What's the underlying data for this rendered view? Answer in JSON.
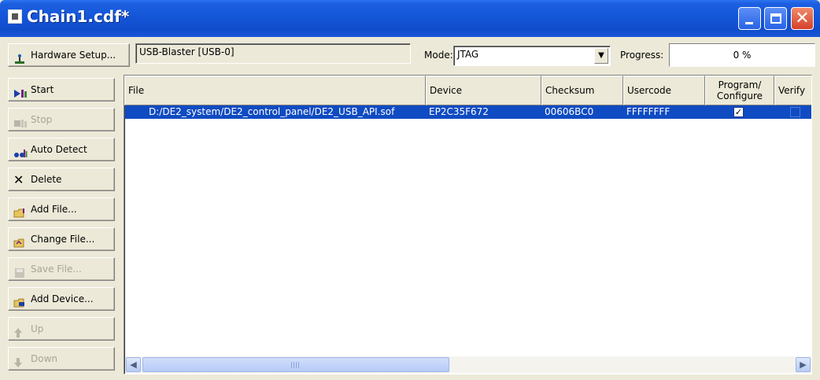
{
  "window": {
    "title": "Chain1.cdf*"
  },
  "toolbar": {
    "hardware_setup_label": "Hardware Setup...",
    "hardware_value": "USB-Blaster [USB-0]",
    "mode_label": "Mode:",
    "mode_value": "JTAG",
    "progress_label": "Progress:",
    "progress_value": "0 %"
  },
  "sidebar": {
    "items": [
      {
        "label": "Start",
        "icon": "start-icon",
        "enabled": true
      },
      {
        "label": "Stop",
        "icon": "stop-icon",
        "enabled": false
      },
      {
        "label": "Auto Detect",
        "icon": "auto-detect-icon",
        "enabled": true
      },
      {
        "label": "Delete",
        "icon": "delete-icon",
        "enabled": true
      },
      {
        "label": "Add File...",
        "icon": "add-file-icon",
        "enabled": true
      },
      {
        "label": "Change File...",
        "icon": "change-file-icon",
        "enabled": true
      },
      {
        "label": "Save File...",
        "icon": "save-file-icon",
        "enabled": false
      },
      {
        "label": "Add Device...",
        "icon": "add-device-icon",
        "enabled": true
      },
      {
        "label": "Up",
        "icon": "up-icon",
        "enabled": false
      },
      {
        "label": "Down",
        "icon": "down-icon",
        "enabled": false
      }
    ]
  },
  "table": {
    "columns": [
      "File",
      "Device",
      "Checksum",
      "Usercode",
      "Program/\nConfigure",
      "Verify"
    ],
    "rows": [
      {
        "file": "D:/DE2_system/DE2_control_panel/DE2_USB_API.sof",
        "device": "EP2C35F672",
        "checksum": "00606BC0",
        "usercode": "FFFFFFFF",
        "program_configure": true,
        "verify": false
      }
    ]
  },
  "colors": {
    "titlebar": "#1456d8",
    "selection": "#0f4bc2",
    "face": "#ece9d8"
  }
}
